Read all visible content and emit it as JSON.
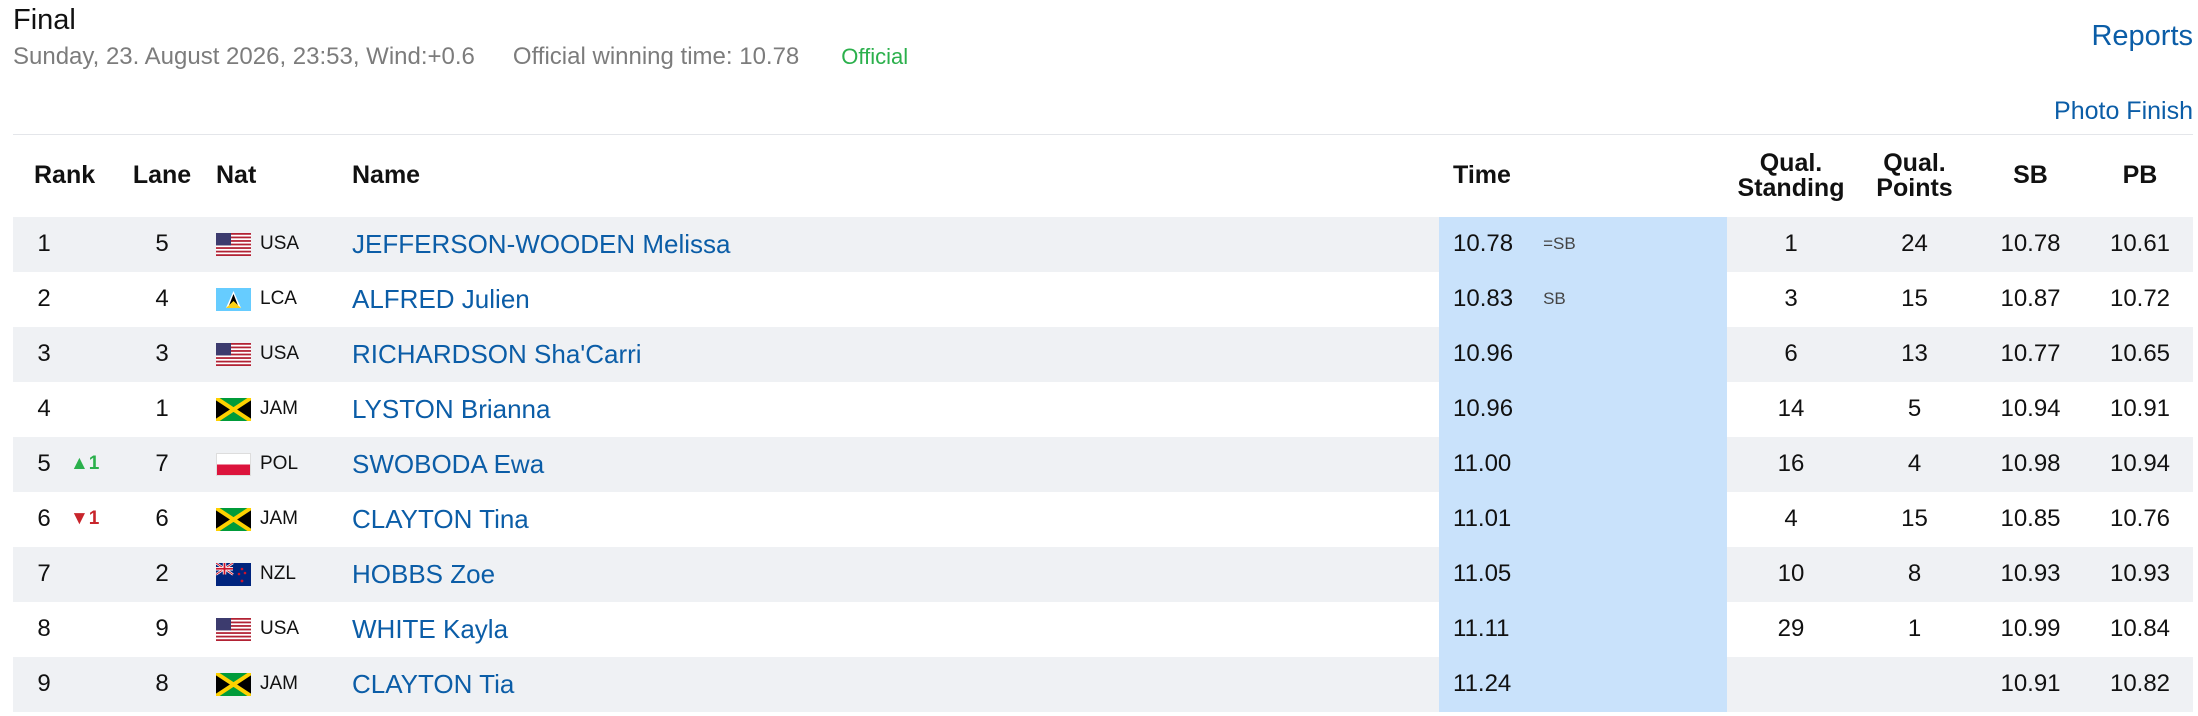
{
  "header": {
    "title": "Final",
    "date": "Sunday, 23. August 2026, 23:53, Wind:+0.6",
    "winning_time": "Official winning time: 10.78",
    "status": "Official",
    "reports_link": "Reports",
    "photo_finish_link": "Photo Finish"
  },
  "table": {
    "columns": {
      "rank": "Rank",
      "lane": "Lane",
      "nat": "Nat",
      "name": "Name",
      "time": "Time",
      "qual_standing_1": "Qual.",
      "qual_standing_2": "Standing",
      "qual_points_1": "Qual.",
      "qual_points_2": "Points",
      "sb": "SB",
      "pb": "PB"
    },
    "rows": [
      {
        "rank": "1",
        "change": "",
        "lane": "5",
        "nat": "USA",
        "name": "JEFFERSON-WOODEN Melissa",
        "time": "10.78",
        "note": "=SB",
        "qual_standing": "1",
        "qual_points": "24",
        "sb": "10.78",
        "pb": "10.61"
      },
      {
        "rank": "2",
        "change": "",
        "lane": "4",
        "nat": "LCA",
        "name": "ALFRED Julien",
        "time": "10.83",
        "note": "SB",
        "qual_standing": "3",
        "qual_points": "15",
        "sb": "10.87",
        "pb": "10.72"
      },
      {
        "rank": "3",
        "change": "",
        "lane": "3",
        "nat": "USA",
        "name": "RICHARDSON Sha'Carri",
        "time": "10.96",
        "note": "",
        "qual_standing": "6",
        "qual_points": "13",
        "sb": "10.77",
        "pb": "10.65"
      },
      {
        "rank": "4",
        "change": "",
        "lane": "1",
        "nat": "JAM",
        "name": "LYSTON Brianna",
        "time": "10.96",
        "note": "",
        "qual_standing": "14",
        "qual_points": "5",
        "sb": "10.94",
        "pb": "10.91"
      },
      {
        "rank": "5",
        "change": "▲1",
        "lane": "7",
        "nat": "POL",
        "name": "SWOBODA Ewa",
        "time": "11.00",
        "note": "",
        "qual_standing": "16",
        "qual_points": "4",
        "sb": "10.98",
        "pb": "10.94"
      },
      {
        "rank": "6",
        "change": "▼1",
        "lane": "6",
        "nat": "JAM",
        "name": "CLAYTON Tina",
        "time": "11.01",
        "note": "",
        "qual_standing": "4",
        "qual_points": "15",
        "sb": "10.85",
        "pb": "10.76"
      },
      {
        "rank": "7",
        "change": "",
        "lane": "2",
        "nat": "NZL",
        "name": "HOBBS Zoe",
        "time": "11.05",
        "note": "",
        "qual_standing": "10",
        "qual_points": "8",
        "sb": "10.93",
        "pb": "10.93"
      },
      {
        "rank": "8",
        "change": "",
        "lane": "9",
        "nat": "USA",
        "name": "WHITE Kayla",
        "time": "11.11",
        "note": "",
        "qual_standing": "29",
        "qual_points": "1",
        "sb": "10.99",
        "pb": "10.84"
      },
      {
        "rank": "9",
        "change": "",
        "lane": "8",
        "nat": "JAM",
        "name": "CLAYTON Tia",
        "time": "11.24",
        "note": "",
        "qual_standing": "",
        "qual_points": "",
        "sb": "10.91",
        "pb": "10.82"
      }
    ]
  },
  "colors": {
    "link": "#0b5da7",
    "official": "#2bb04c",
    "rank_up": "#2bb04c",
    "rank_down": "#c8252c",
    "time_column_bg": "#c9e2fb",
    "row_stripe": "#eff1f4"
  }
}
